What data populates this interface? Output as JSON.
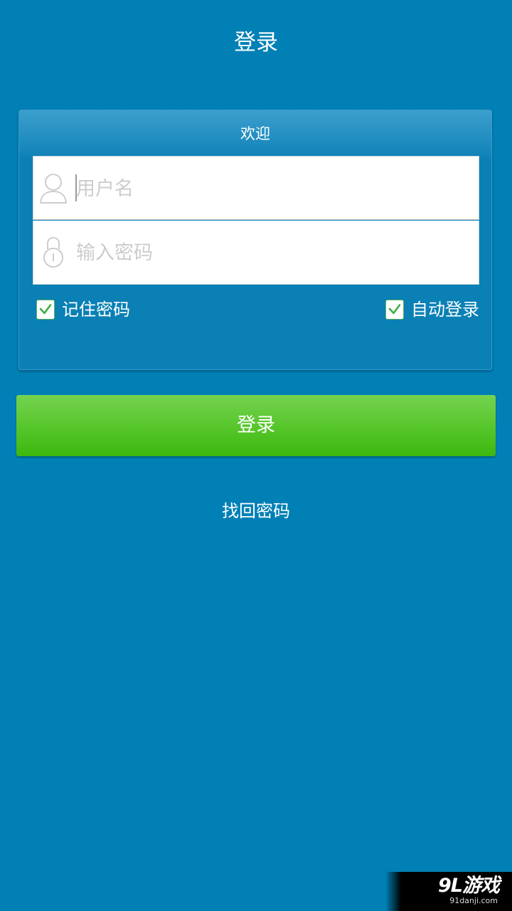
{
  "header": {
    "title": "登录"
  },
  "login_card": {
    "welcome": "欢迎",
    "username": {
      "placeholder": "用户名",
      "value": "",
      "icon": "user-icon"
    },
    "password": {
      "placeholder": "输入密码",
      "value": "",
      "icon": "lock-icon"
    },
    "remember_password": {
      "label": "记住密码",
      "checked": true
    },
    "auto_login": {
      "label": "自动登录",
      "checked": true
    }
  },
  "login_button": {
    "label": "登录"
  },
  "forgot_password": {
    "label": "找回密码"
  },
  "watermark": {
    "logo": "9L游戏",
    "url": "91danji.com"
  },
  "colors": {
    "background": "#0080b5",
    "button_green": "#4cc11e",
    "checkbox_green": "#3cb043"
  }
}
